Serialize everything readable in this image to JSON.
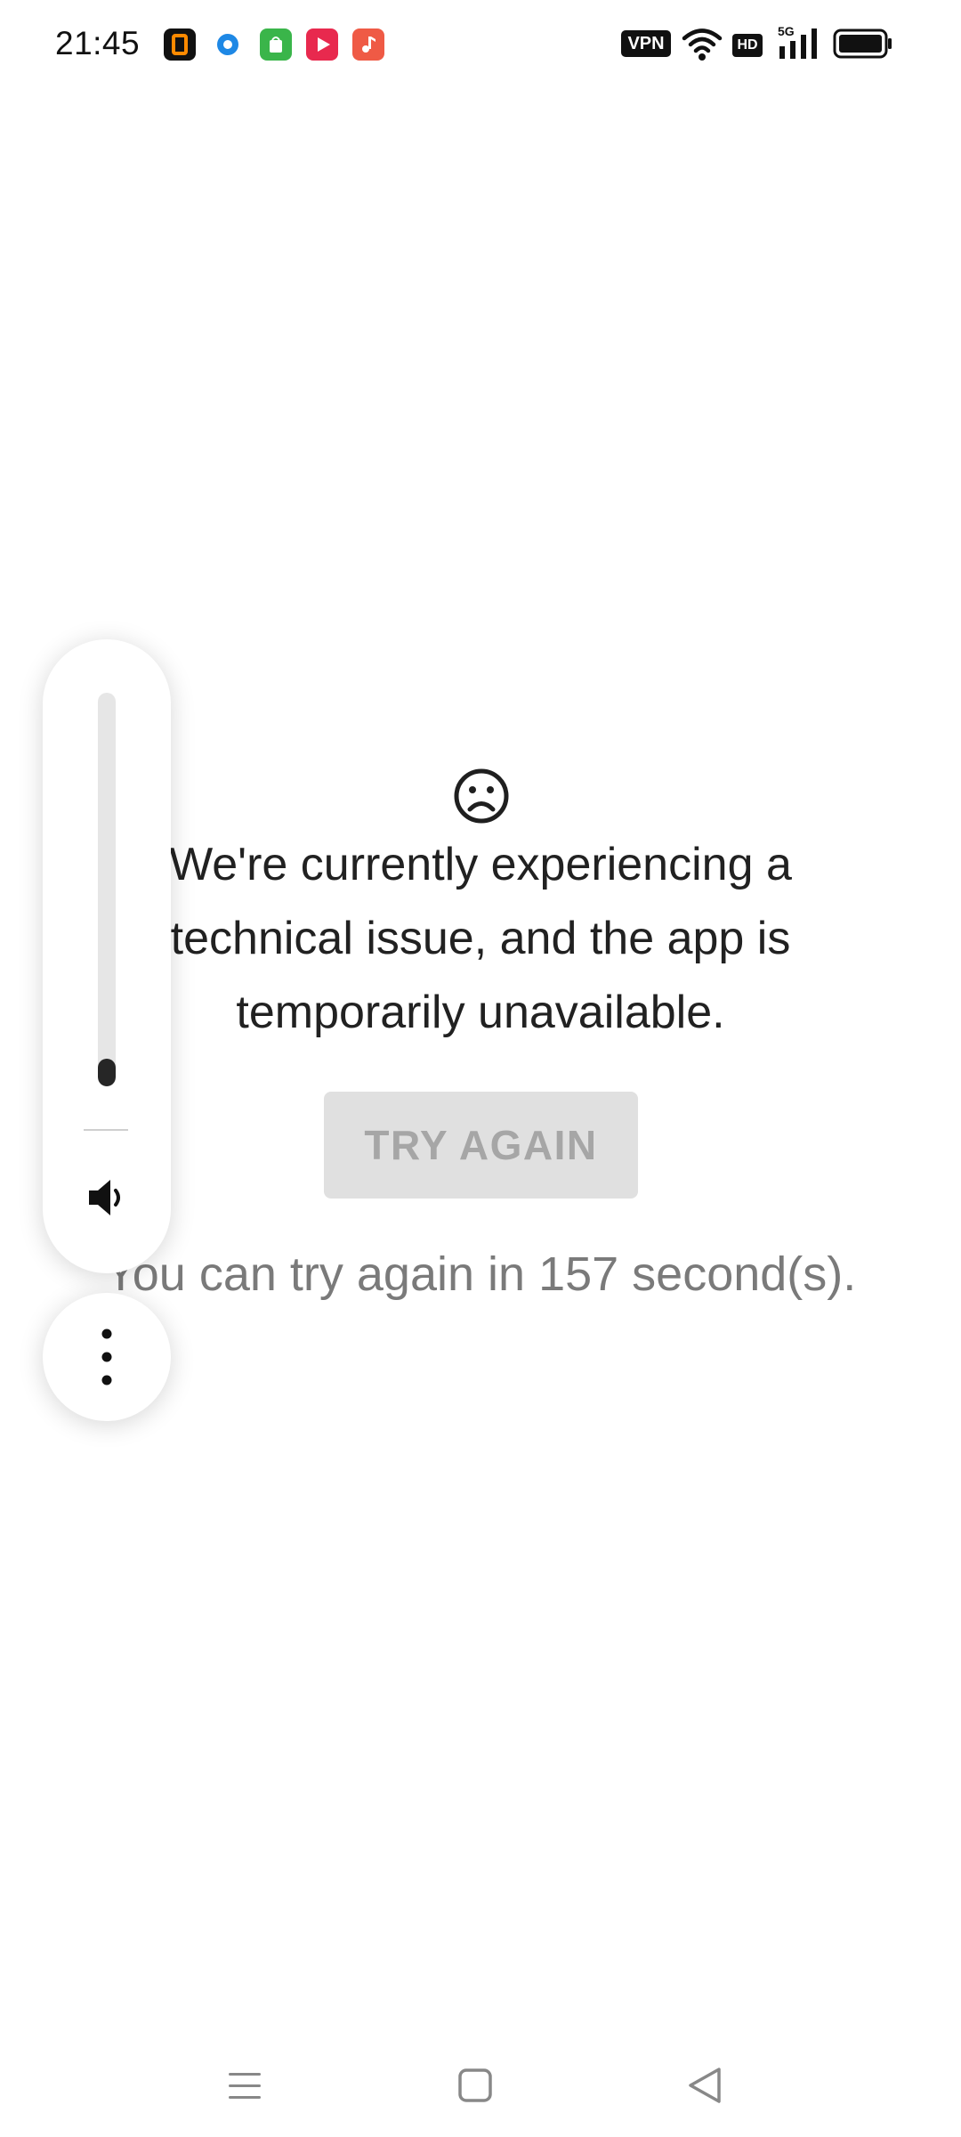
{
  "status_bar": {
    "time": "21:45",
    "notification_icons": [
      "orange-frame-app-icon",
      "blue-dot-app-icon",
      "green-shopping-app-icon",
      "red-video-play-app-icon",
      "red-music-app-icon"
    ],
    "vpn_label": "VPN",
    "hd_label": "HD",
    "network_label": "5G",
    "icons": [
      "wifi-icon",
      "signal-icon",
      "battery-icon"
    ],
    "battery_level": 1.0
  },
  "error": {
    "icon": "sad-face-icon",
    "message": "We're currently experiencing a technical issue, and the app is temporarily unavailable.",
    "button_label": "TRY AGAIN",
    "countdown": "You can try again in 157 second(s)."
  },
  "volume_panel": {
    "level": 0.07,
    "icons": [
      "speaker-icon",
      "more-vertical-icon"
    ]
  },
  "nav_bar": {
    "icons": [
      "menu-icon",
      "home-icon",
      "back-icon"
    ]
  },
  "colors": {
    "background": "#ffffff",
    "text_primary": "#212121",
    "text_secondary": "#7a7a7a",
    "button_disabled_bg": "#e0e0e0",
    "button_disabled_text": "#a6a6a6",
    "volume_fill": "#262626",
    "volume_track": "#e6e6e6"
  }
}
